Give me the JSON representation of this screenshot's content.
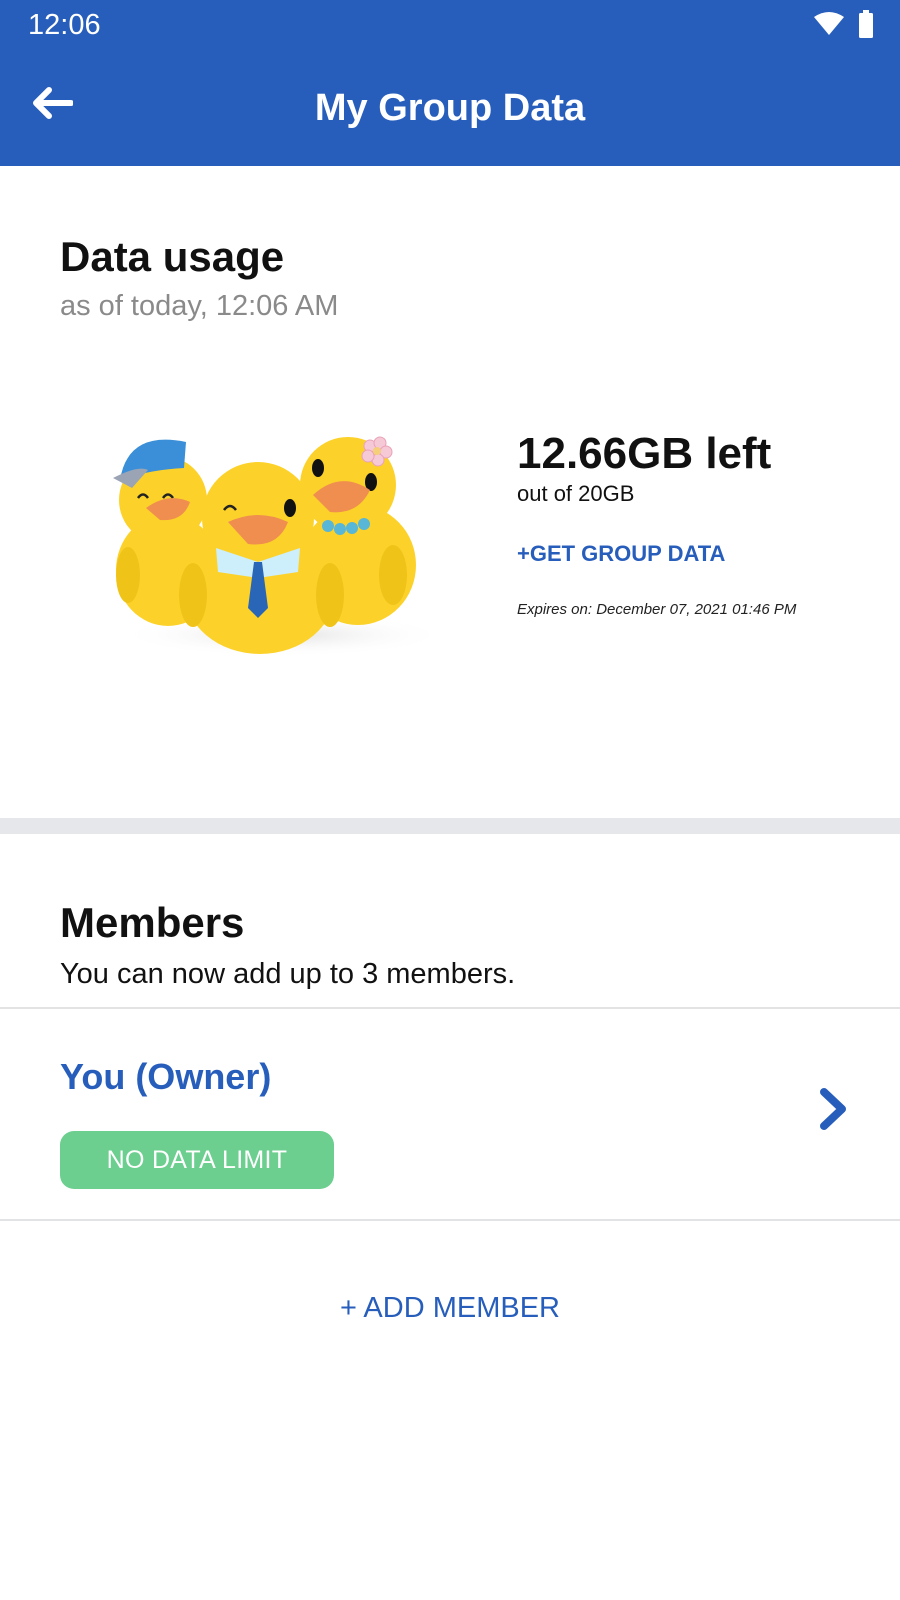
{
  "status_bar": {
    "time": "12:06",
    "icons": [
      "wifi-icon",
      "battery-icon"
    ]
  },
  "app_bar": {
    "title": "My Group Data",
    "back_icon": "arrow-left-icon"
  },
  "data_usage": {
    "title": "Data usage",
    "as_of": "as of today, 12:06 AM",
    "remaining": "12.66GB left",
    "total": "out of 20GB",
    "remaining_fraction": 0.633,
    "get_data_label": "+GET GROUP DATA",
    "expires": "Expires on: December 07, 2021 01:46 PM"
  },
  "members": {
    "title": "Members",
    "subtitle": "You can now add up to 3 members.",
    "items": [
      {
        "name": "You (Owner)",
        "badge": "NO DATA LIMIT",
        "chevron_icon": "chevron-right-icon"
      }
    ],
    "add_label": "+ ADD MEMBER"
  },
  "colors": {
    "primary": "#285ebb",
    "badge_green": "#6ccf8f",
    "divider": "#e6e7ea",
    "muted_text": "#8a8a8a"
  }
}
